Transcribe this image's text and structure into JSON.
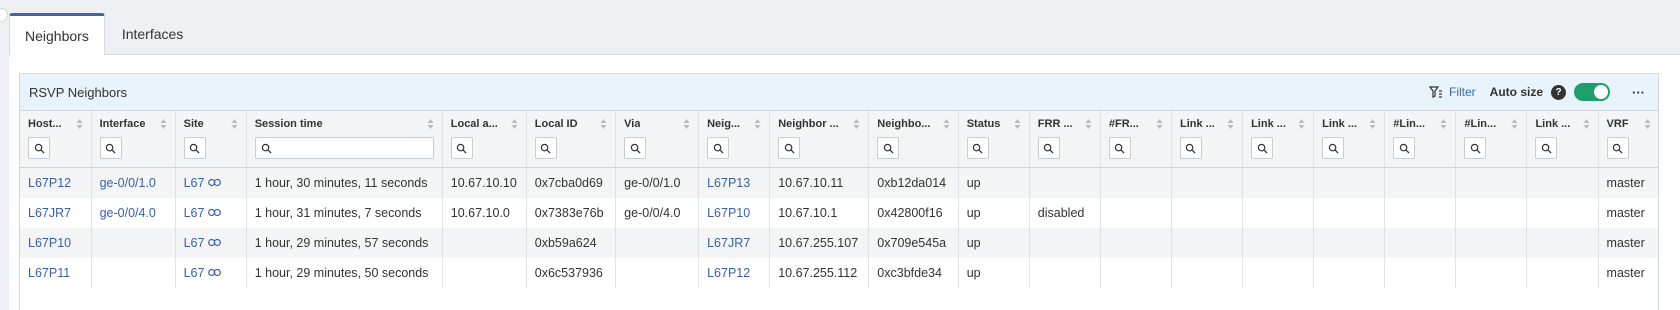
{
  "tabs": [
    {
      "label": "Neighbors",
      "active": true
    },
    {
      "label": "Interfaces",
      "active": false
    }
  ],
  "panel": {
    "title": "RSVP Neighbors",
    "filter_label": "Filter",
    "autosize_label": "Auto size",
    "help_label": "?",
    "autosize_on": true,
    "more_label": "···"
  },
  "columns": [
    {
      "label": "Host..."
    },
    {
      "label": "Interface"
    },
    {
      "label": "Site"
    },
    {
      "label": "Session time"
    },
    {
      "label": "Local a..."
    },
    {
      "label": "Local ID"
    },
    {
      "label": "Via"
    },
    {
      "label": "Neig..."
    },
    {
      "label": "Neighbor ..."
    },
    {
      "label": "Neighbo..."
    },
    {
      "label": "Status"
    },
    {
      "label": "FRR ..."
    },
    {
      "label": "#FR..."
    },
    {
      "label": "Link ..."
    },
    {
      "label": "Link ..."
    },
    {
      "label": "Link ..."
    },
    {
      "label": "#Lin..."
    },
    {
      "label": "#Lin..."
    },
    {
      "label": "Link ..."
    },
    {
      "label": "VRF"
    }
  ],
  "rows": [
    {
      "host": "L67P12",
      "interface": "ge-0/0/1.0",
      "site": "L67",
      "session_time": "1 hour, 30 minutes, 11 seconds",
      "local_addr": "10.67.10.10",
      "local_id": "0x7cba0d69",
      "via": "ge-0/0/1.0",
      "neighbor": "L67P13",
      "neighbor_addr": "10.67.10.11",
      "neighbor_id": "0xb12da014",
      "status": "up",
      "frr": "",
      "vrf": "master"
    },
    {
      "host": "L67JR7",
      "interface": "ge-0/0/4.0",
      "site": "L67",
      "session_time": "1 hour, 31 minutes, 7 seconds",
      "local_addr": "10.67.10.0",
      "local_id": "0x7383e76b",
      "via": "ge-0/0/4.0",
      "neighbor": "L67P10",
      "neighbor_addr": "10.67.10.1",
      "neighbor_id": "0x42800f16",
      "status": "up",
      "frr": "disabled",
      "vrf": "master"
    },
    {
      "host": "L67P10",
      "interface": "",
      "site": "L67",
      "session_time": "1 hour, 29 minutes, 57 seconds",
      "local_addr": "",
      "local_id": "0xb59a624",
      "via": "",
      "neighbor": "L67JR7",
      "neighbor_addr": "10.67.255.107",
      "neighbor_id": "0x709e545a",
      "status": "up",
      "frr": "",
      "vrf": "master"
    },
    {
      "host": "L67P11",
      "interface": "",
      "site": "L67",
      "session_time": "1 hour, 29 minutes, 50 seconds",
      "local_addr": "",
      "local_id": "0x6c537936",
      "via": "",
      "neighbor": "L67P12",
      "neighbor_addr": "10.67.255.112",
      "neighbor_id": "0xc3bfde34",
      "status": "up",
      "frr": "",
      "vrf": "master"
    }
  ]
}
